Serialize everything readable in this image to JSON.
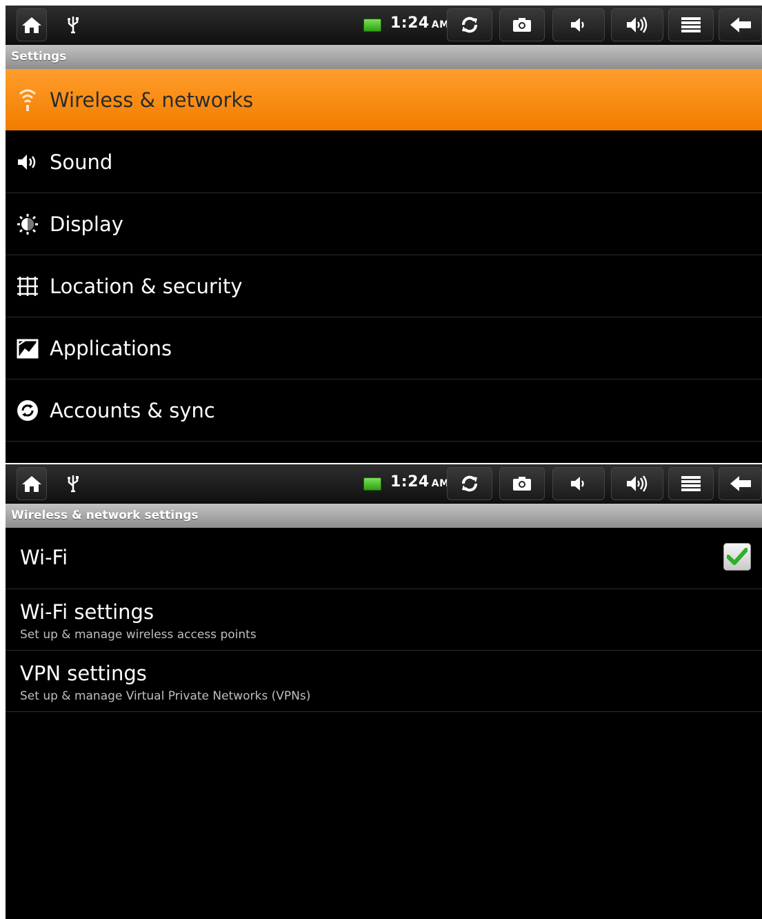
{
  "status_bar": {
    "time": "1:24",
    "ampm": "AM",
    "icons": [
      "home-icon",
      "usb-icon",
      "battery-icon",
      "refresh-icon",
      "camera-icon",
      "volume-down-icon",
      "volume-up-icon",
      "menu-icon",
      "back-arrow-icon"
    ],
    "battery_color": "#3cc21a"
  },
  "screen1": {
    "title": "Settings",
    "items": [
      {
        "label": "Wireless & networks",
        "icon": "wifi-icon",
        "selected": true
      },
      {
        "label": "Sound",
        "icon": "speaker-icon"
      },
      {
        "label": "Display",
        "icon": "brightness-icon"
      },
      {
        "label": "Location & security",
        "icon": "location-grid-icon"
      },
      {
        "label": "Applications",
        "icon": "applications-icon"
      },
      {
        "label": "Accounts & sync",
        "icon": "sync-icon"
      }
    ],
    "accent_color": "#f88a10"
  },
  "screen2": {
    "title": "Wireless & network settings",
    "items": [
      {
        "title": "Wi-Fi",
        "checked": true
      },
      {
        "title": "Wi-Fi settings",
        "summary": "Set up & manage wireless access points"
      },
      {
        "title": "VPN settings",
        "summary": "Set up & manage Virtual Private Networks (VPNs)"
      }
    ]
  }
}
